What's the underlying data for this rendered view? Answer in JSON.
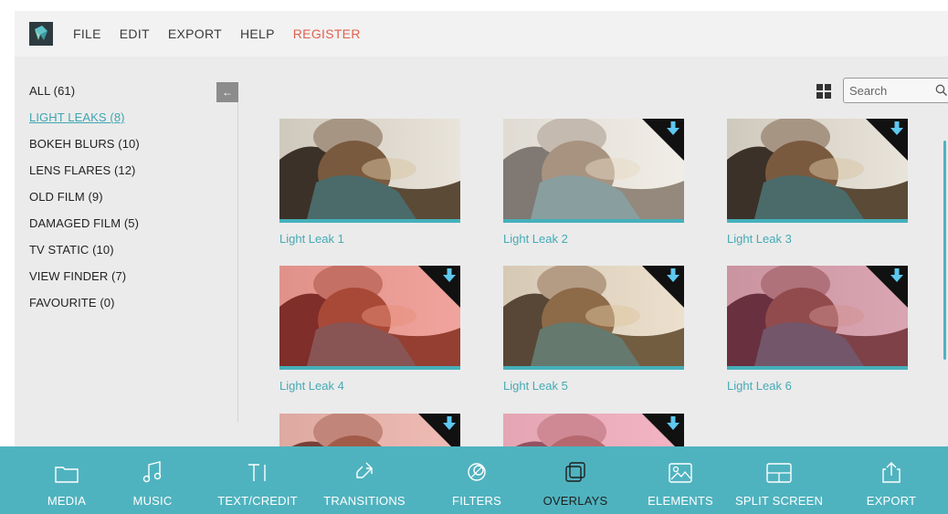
{
  "menu": {
    "items": [
      "FILE",
      "EDIT",
      "EXPORT",
      "HELP"
    ],
    "register": "REGISTER"
  },
  "categories": [
    {
      "label": "ALL (61)",
      "active": false
    },
    {
      "label": "LIGHT LEAKS (8)",
      "active": true
    },
    {
      "label": "BOKEH BLURS (10)",
      "active": false
    },
    {
      "label": "LENS FLARES (12)",
      "active": false
    },
    {
      "label": "OLD FILM (9)",
      "active": false
    },
    {
      "label": "DAMAGED FILM (5)",
      "active": false
    },
    {
      "label": "TV STATIC (10)",
      "active": false
    },
    {
      "label": "VIEW FINDER (7)",
      "active": false
    },
    {
      "label": "FAVOURITE (0)",
      "active": false
    }
  ],
  "search": {
    "placeholder": "Search"
  },
  "tiles": [
    {
      "label": "Light Leak 1",
      "download": false,
      "tint": "#ffffff",
      "tint_opacity": 0.0
    },
    {
      "label": "Light Leak 2",
      "download": true,
      "tint": "#ffffff",
      "tint_opacity": 0.35
    },
    {
      "label": "Light Leak 3",
      "download": true,
      "tint": "#ffffff",
      "tint_opacity": 0.0
    },
    {
      "label": "Light Leak 4",
      "download": true,
      "tint": "#ff2a2a",
      "tint_opacity": 0.35
    },
    {
      "label": "Light Leak 5",
      "download": true,
      "tint": "#ffcc88",
      "tint_opacity": 0.15
    },
    {
      "label": "Light Leak 6",
      "download": true,
      "tint": "#c0306a",
      "tint_opacity": 0.35
    },
    {
      "label": "",
      "download": true,
      "tint": "#ff6060",
      "tint_opacity": 0.3
    },
    {
      "label": "",
      "download": true,
      "tint": "#ff7aa8",
      "tint_opacity": 0.45
    }
  ],
  "tools": [
    {
      "label": "MEDIA",
      "icon": "folder-icon",
      "active": false
    },
    {
      "label": "MUSIC",
      "icon": "music-note-icon",
      "active": false
    },
    {
      "label": "TEXT/CREDIT",
      "icon": "text-icon",
      "active": false
    },
    {
      "label": "TRANSITIONS",
      "icon": "transitions-icon",
      "active": false
    },
    {
      "label": "FILTERS",
      "icon": "filters-icon",
      "active": false
    },
    {
      "label": "OVERLAYS",
      "icon": "overlays-icon",
      "active": true
    },
    {
      "label": "ELEMENTS",
      "icon": "elements-icon",
      "active": false
    },
    {
      "label": "SPLIT SCREEN",
      "icon": "split-screen-icon",
      "active": false
    },
    {
      "label": "EXPORT",
      "icon": "export-icon",
      "active": false
    }
  ],
  "colors": {
    "accent": "#4fb3bf",
    "register": "#e0604f",
    "active_tool": "#1f1f1f"
  }
}
